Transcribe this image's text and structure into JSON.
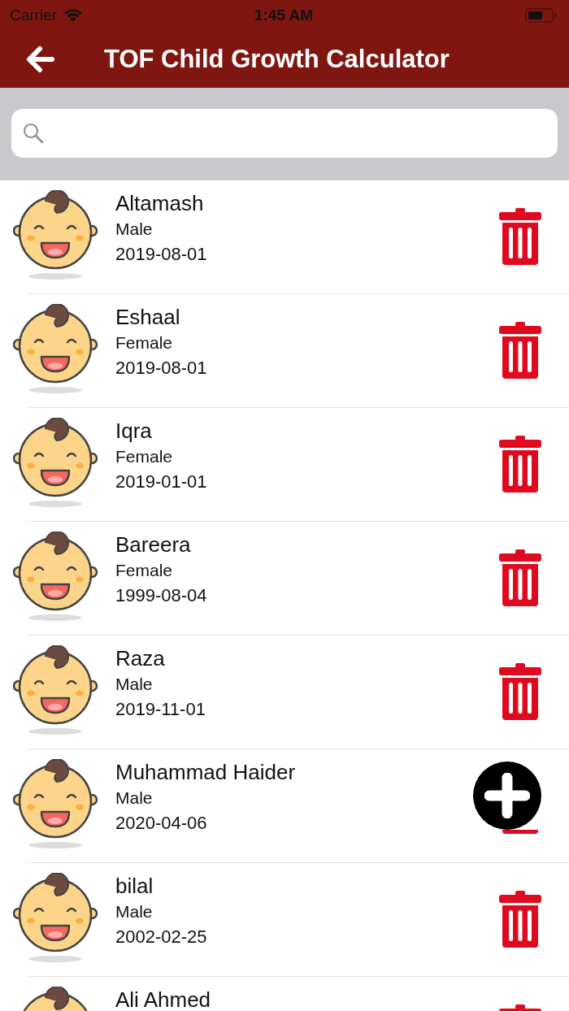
{
  "status_bar": {
    "carrier": "Carrier",
    "time": "1:45 AM"
  },
  "nav_bar": {
    "title": "TOF Child Growth Calculator"
  },
  "children": [
    {
      "name": "Altamash",
      "gender": "Male",
      "birth_date": "2019-08-01"
    },
    {
      "name": "Eshaal",
      "gender": "Female",
      "birth_date": "2019-08-01"
    },
    {
      "name": "Iqra",
      "gender": "Female",
      "birth_date": "2019-01-01"
    },
    {
      "name": "Bareera",
      "gender": "Female",
      "birth_date": "1999-08-04"
    },
    {
      "name": "Raza",
      "gender": "Male",
      "birth_date": "2019-11-01"
    },
    {
      "name": "Muhammad Haider",
      "gender": "Male",
      "birth_date": "2020-04-06",
      "covered": true
    },
    {
      "name": "bilal",
      "gender": "Male",
      "birth_date": "2002-02-25"
    },
    {
      "name": "Ali Ahmed"
    }
  ]
}
